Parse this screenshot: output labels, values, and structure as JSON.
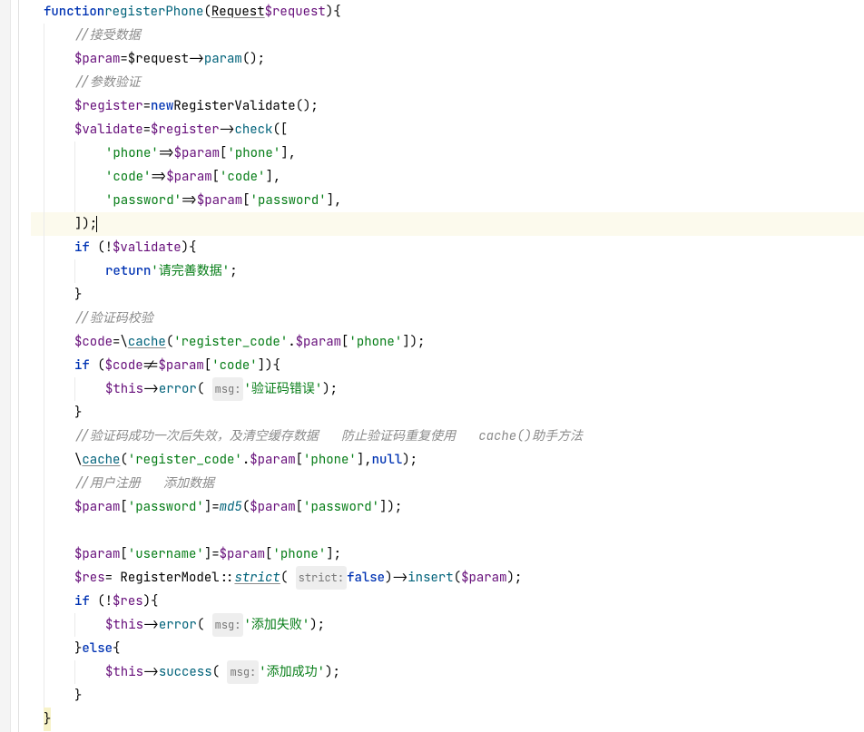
{
  "lines": {
    "l1": {
      "kw": "function",
      "fn": "registerPhone",
      "pcls": "Request",
      "pvar": "$request"
    },
    "l2": "//接受数据",
    "l3": {
      "v": "$param",
      "m": "param"
    },
    "l4": "//参数验证",
    "l5": {
      "v": "$register",
      "kw": "new",
      "cls": "RegisterValidate"
    },
    "l6": {
      "v1": "$validate",
      "v2": "$register",
      "m": "check"
    },
    "l7": {
      "k": "'phone'",
      "v": "$param",
      "idx": "'phone'"
    },
    "l8": {
      "k": "'code'",
      "v": "$param",
      "idx": "'code'"
    },
    "l9": {
      "k": "'password'",
      "v": "$param",
      "idx": "'password'"
    },
    "l10": "]);",
    "l11": {
      "kw": "if",
      "v": "$validate"
    },
    "l12": {
      "kw": "return",
      "s": "'请完善数据'"
    },
    "l13": "}",
    "l14": "//验证码校验",
    "l15": {
      "v1": "$code",
      "fn": "cache",
      "s": "'register_code'",
      "v2": "$param",
      "idx": "'phone'"
    },
    "l16": {
      "kw": "if",
      "v1": "$code",
      "v2": "$param",
      "idx": "'code'"
    },
    "l17": {
      "v": "$this",
      "m": "error",
      "hint": "msg:",
      "s": "'验证码错误'"
    },
    "l18": "}",
    "l19": "//验证码成功一次后失效，及清空缓存数据   防止验证码重复使用   cache()助手方法",
    "l20": {
      "fn": "cache",
      "s": "'register_code'",
      "v": "$param",
      "idx": "'phone'",
      "kw": "null"
    },
    "l21": "//用户注册   添加数据",
    "l22": {
      "v": "$param",
      "idx1": "'password'",
      "fn": "md5",
      "idx2": "'password'"
    },
    "l23": {
      "v": "$param",
      "idx1": "'username'",
      "idx2": "'phone'"
    },
    "l24": {
      "v1": "$res",
      "cls": "RegisterModel",
      "m1": "strict",
      "hint": "strict:",
      "kw": "false",
      "m2": "insert",
      "v2": "$param"
    },
    "l25": {
      "kw": "if",
      "v": "$res"
    },
    "l26": {
      "v": "$this",
      "m": "error",
      "hint": "msg:",
      "s": "'添加失败'"
    },
    "l27": {
      "kw": "else"
    },
    "l28": {
      "v": "$this",
      "m": "success",
      "hint": "msg:",
      "s": "'添加成功'"
    },
    "l29": "}",
    "l30": "}"
  }
}
